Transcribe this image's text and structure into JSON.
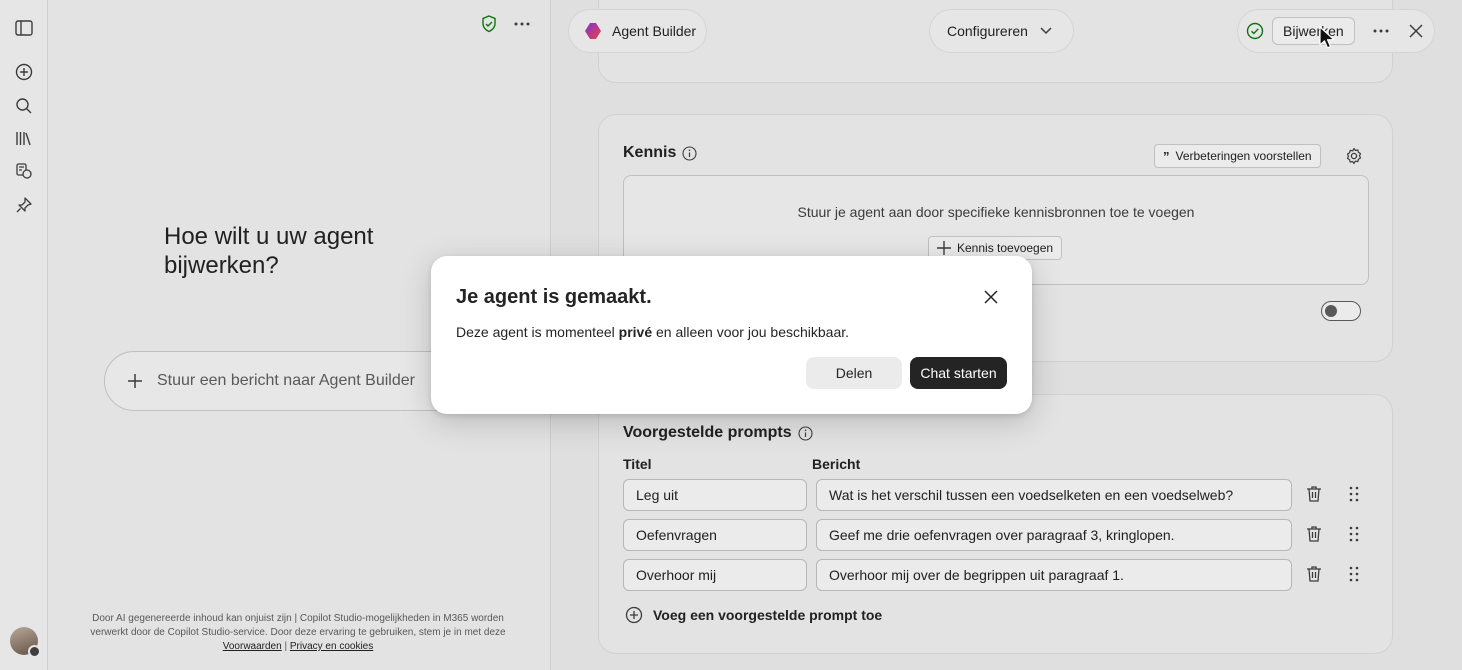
{
  "left_pane": {
    "heading": "Hoe wilt u uw agent bijwerken?",
    "composer_placeholder": "Stuur een bericht naar Agent Builder",
    "disclaimer": "Door AI gegenereerde inhoud kan onjuist zijn | Copilot Studio-mogelijkheden in M365 worden verwerkt door de Copilot Studio-service. Door deze ervaring te gebruiken, stem je in met deze",
    "terms_link": "Voorwaarden",
    "separator": "|",
    "privacy_link": "Privacy en cookies"
  },
  "topbar": {
    "agent_builder_label": "Agent Builder",
    "configure_label": "Configureren",
    "update_label": "Bijwerken"
  },
  "knowledge": {
    "title": "Kennis",
    "suggest_label": "Verbeteringen voorstellen",
    "hint": "Stuur je agent aan door specifieke kennisbronnen toe te voegen",
    "add_label": "Kennis toevoegen"
  },
  "prompts": {
    "title": "Voorgestelde prompts",
    "col_title": "Titel",
    "col_message": "Bericht",
    "rows": [
      {
        "title": "Leg uit",
        "message": "Wat is het verschil tussen een voedselketen en een voedselweb?"
      },
      {
        "title": "Oefenvragen",
        "message": "Geef me drie oefenvragen over paragraaf 3, kringlopen."
      },
      {
        "title": "Overhoor mij",
        "message": "Overhoor mij over de begrippen uit paragraaf 1."
      }
    ],
    "add_label": "Voeg een voorgestelde prompt toe"
  },
  "dialog": {
    "title": "Je agent is gemaakt.",
    "body_prefix": "Deze agent is momenteel ",
    "body_bold": "privé",
    "body_suffix": " en alleen voor jou beschikbaar.",
    "share_label": "Delen",
    "start_chat_label": "Chat starten"
  },
  "colors": {
    "primary_button": "#242424",
    "success_icon": "#107c10",
    "copilot_logo_start": "#7b3fe4",
    "copilot_logo_end": "#e8563f"
  }
}
